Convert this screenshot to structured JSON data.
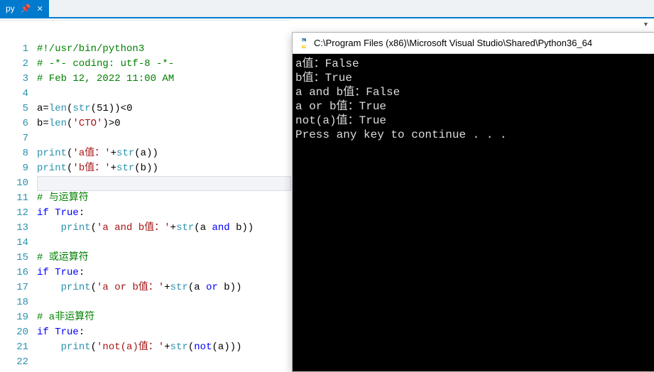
{
  "tab": {
    "label": "py",
    "pin_glyph": "📌",
    "close_glyph": "✕"
  },
  "code_lines": [
    [
      {
        "cls": "c-cmt",
        "t": "#!/usr/bin/python3"
      }
    ],
    [
      {
        "cls": "c-cmt",
        "t": "# -*- coding: utf-8 -*-"
      }
    ],
    [
      {
        "cls": "c-cmt",
        "t": "# Feb 12, 2022 11:00 AM"
      }
    ],
    [],
    [
      {
        "cls": "c-id",
        "t": "a"
      },
      {
        "cls": "c-op",
        "t": "="
      },
      {
        "cls": "c-builtin",
        "t": "len"
      },
      {
        "cls": "c-op",
        "t": "("
      },
      {
        "cls": "c-builtin",
        "t": "str"
      },
      {
        "cls": "c-op",
        "t": "("
      },
      {
        "cls": "c-num",
        "t": "51"
      },
      {
        "cls": "c-op",
        "t": "))<"
      },
      {
        "cls": "c-num",
        "t": "0"
      }
    ],
    [
      {
        "cls": "c-id",
        "t": "b"
      },
      {
        "cls": "c-op",
        "t": "="
      },
      {
        "cls": "c-builtin",
        "t": "len"
      },
      {
        "cls": "c-op",
        "t": "("
      },
      {
        "cls": "c-str",
        "t": "'CTO'"
      },
      {
        "cls": "c-op",
        "t": ")>"
      },
      {
        "cls": "c-num",
        "t": "0"
      }
    ],
    [],
    [
      {
        "cls": "c-builtin",
        "t": "print"
      },
      {
        "cls": "c-op",
        "t": "("
      },
      {
        "cls": "c-str",
        "t": "'a值：'"
      },
      {
        "cls": "c-op",
        "t": "+"
      },
      {
        "cls": "c-builtin",
        "t": "str"
      },
      {
        "cls": "c-op",
        "t": "("
      },
      {
        "cls": "c-id",
        "t": "a"
      },
      {
        "cls": "c-op",
        "t": "))"
      }
    ],
    [
      {
        "cls": "c-builtin",
        "t": "print"
      },
      {
        "cls": "c-op",
        "t": "("
      },
      {
        "cls": "c-str",
        "t": "'b值：'"
      },
      {
        "cls": "c-op",
        "t": "+"
      },
      {
        "cls": "c-builtin",
        "t": "str"
      },
      {
        "cls": "c-op",
        "t": "("
      },
      {
        "cls": "c-id",
        "t": "b"
      },
      {
        "cls": "c-op",
        "t": "))"
      }
    ],
    [],
    [
      {
        "cls": "c-cmt",
        "t": "# 与运算符"
      }
    ],
    [
      {
        "cls": "c-kw",
        "t": "if"
      },
      {
        "cls": "",
        "t": " "
      },
      {
        "cls": "c-kw",
        "t": "True"
      },
      {
        "cls": "c-op",
        "t": ":"
      }
    ],
    [
      {
        "cls": "",
        "t": "    "
      },
      {
        "cls": "c-builtin",
        "t": "print"
      },
      {
        "cls": "c-op",
        "t": "("
      },
      {
        "cls": "c-str",
        "t": "'a and b值：'"
      },
      {
        "cls": "c-op",
        "t": "+"
      },
      {
        "cls": "c-builtin",
        "t": "str"
      },
      {
        "cls": "c-op",
        "t": "("
      },
      {
        "cls": "c-id",
        "t": "a "
      },
      {
        "cls": "c-kw",
        "t": "and"
      },
      {
        "cls": "c-id",
        "t": " b"
      },
      {
        "cls": "c-op",
        "t": "))"
      }
    ],
    [],
    [
      {
        "cls": "c-cmt",
        "t": "# 或运算符"
      }
    ],
    [
      {
        "cls": "c-kw",
        "t": "if"
      },
      {
        "cls": "",
        "t": " "
      },
      {
        "cls": "c-kw",
        "t": "True"
      },
      {
        "cls": "c-op",
        "t": ":"
      }
    ],
    [
      {
        "cls": "",
        "t": "    "
      },
      {
        "cls": "c-builtin",
        "t": "print"
      },
      {
        "cls": "c-op",
        "t": "("
      },
      {
        "cls": "c-str",
        "t": "'a or b值：'"
      },
      {
        "cls": "c-op",
        "t": "+"
      },
      {
        "cls": "c-builtin",
        "t": "str"
      },
      {
        "cls": "c-op",
        "t": "("
      },
      {
        "cls": "c-id",
        "t": "a "
      },
      {
        "cls": "c-kw",
        "t": "or"
      },
      {
        "cls": "c-id",
        "t": " b"
      },
      {
        "cls": "c-op",
        "t": "))"
      }
    ],
    [],
    [
      {
        "cls": "c-cmt",
        "t": "# a非运算符"
      }
    ],
    [
      {
        "cls": "c-kw",
        "t": "if"
      },
      {
        "cls": "",
        "t": " "
      },
      {
        "cls": "c-kw",
        "t": "True"
      },
      {
        "cls": "c-op",
        "t": ":"
      }
    ],
    [
      {
        "cls": "",
        "t": "    "
      },
      {
        "cls": "c-builtin",
        "t": "print"
      },
      {
        "cls": "c-op",
        "t": "("
      },
      {
        "cls": "c-str",
        "t": "'not(a)值：'"
      },
      {
        "cls": "c-op",
        "t": "+"
      },
      {
        "cls": "c-builtin",
        "t": "str"
      },
      {
        "cls": "c-op",
        "t": "("
      },
      {
        "cls": "c-kw",
        "t": "not"
      },
      {
        "cls": "c-op",
        "t": "("
      },
      {
        "cls": "c-id",
        "t": "a"
      },
      {
        "cls": "c-op",
        "t": ")))"
      }
    ],
    []
  ],
  "highlight_line": 10,
  "console": {
    "title": "C:\\Program Files (x86)\\Microsoft Visual Studio\\Shared\\Python36_64",
    "lines": [
      "a值：False",
      "b值：True",
      "a and b值：False",
      "a or b值：True",
      "not(a)值：True",
      "Press any key to continue . . ."
    ]
  }
}
